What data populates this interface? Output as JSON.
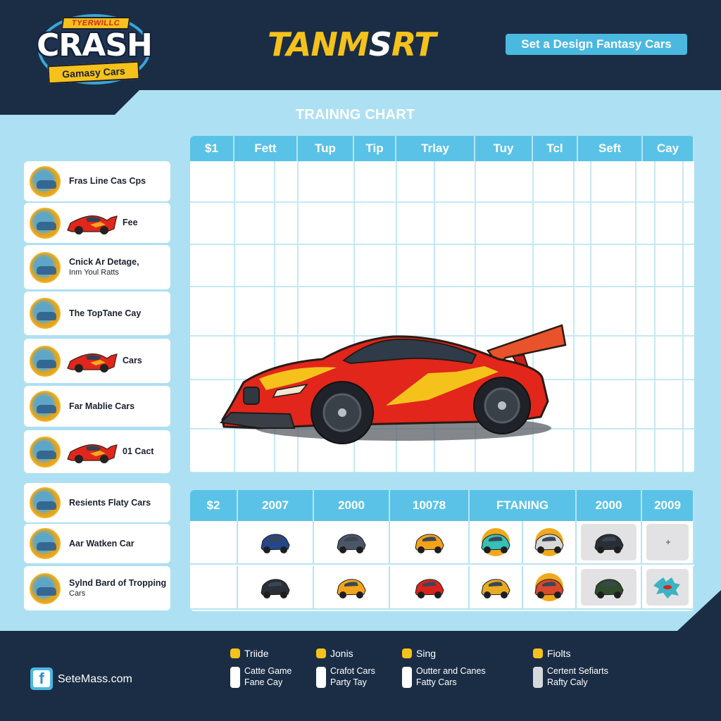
{
  "header": {
    "logo": {
      "top_ribbon": "TYERWILLC",
      "main_word": "CRASH",
      "bottom_ribbon": "Gamasy Cars"
    },
    "title": {
      "part_a": "TANM",
      "part_b": "S",
      "part_c": "RT"
    },
    "cta_label": "Set a Design Fantasy Cars"
  },
  "chart_title": "TRAINNG CHART",
  "sidebar": {
    "items": [
      {
        "label": "Fras Line Cas Cps",
        "sub": "",
        "has_car": false
      },
      {
        "label": "Fee",
        "sub": "",
        "has_car": true
      },
      {
        "label": "Cnick Ar Detage,",
        "sub": "Inm Youl Ratts",
        "has_car": false
      },
      {
        "label": "The TopTane Cay",
        "sub": "",
        "has_car": false
      },
      {
        "label": "Cars",
        "sub": "",
        "has_car": true
      },
      {
        "label": "Far Mablie Cars",
        "sub": "",
        "has_car": false
      },
      {
        "label": "01 Cact",
        "sub": "",
        "has_car": true
      },
      {
        "label": "Resients Flaty Cars",
        "sub": "",
        "has_car": false
      },
      {
        "label": "Aar Watken Car",
        "sub": "",
        "has_car": false
      },
      {
        "label": "Sylnd Bard of Tropping",
        "sub": "Cars",
        "has_car": false
      }
    ]
  },
  "training_grid": {
    "columns": [
      "$1",
      "Fett",
      "Tup",
      "Tip",
      "Trlay",
      "Tuy",
      "Tcl",
      "Seft",
      "Cay"
    ]
  },
  "car_grid": {
    "columns": [
      "$2",
      "2007",
      "2000",
      "10078",
      "FTANING",
      "2000",
      "2009"
    ],
    "rows": [
      [
        "",
        "blue-hatchback",
        "grey-hatchback",
        "orange-sports-car",
        "teal-car-badge",
        "white-car-badge",
        "black-suv",
        "small-plus"
      ],
      [
        "",
        "black-offroad",
        "orange-coupe",
        "red-rally-car",
        "yellow-buggy",
        "arcade-badge",
        "green-suv",
        "teal-splash"
      ]
    ]
  },
  "footer": {
    "social_icon": "facebook-icon",
    "site": "SeteMass.com",
    "legend": [
      {
        "name": "Triide",
        "desc_line1": "Catte Game",
        "desc_line2": "Fane Cay",
        "bar_color": "#ffffff"
      },
      {
        "name": "Jonis",
        "desc_line1": "Crafot Cars",
        "desc_line2": "Party Tay",
        "bar_color": "#ffffff"
      },
      {
        "name": "Sing",
        "desc_line1": "Outter and Canes",
        "desc_line2": "Fatty Cars",
        "bar_color": "#ffffff"
      },
      {
        "name": "Fiolts",
        "desc_line1": "Certent Sefiarts",
        "desc_line2": "Rafty Caly",
        "bar_color": "#d6d9dc"
      }
    ]
  },
  "colors": {
    "navy": "#1b2d45",
    "panel": "#ade0f2",
    "header_blue": "#5ac2e6",
    "accent_yellow": "#f5c21b",
    "car_red": "#e2261b"
  }
}
